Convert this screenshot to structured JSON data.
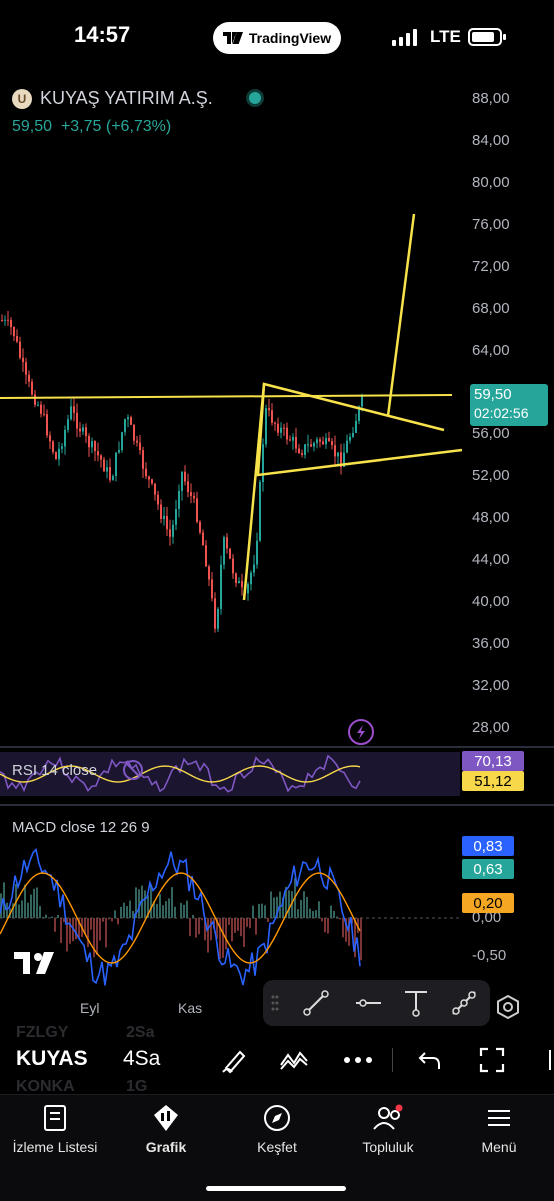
{
  "status_bar": {
    "time": "14:57",
    "center_app": "TradingView",
    "network": "LTE"
  },
  "header": {
    "logo_letter": "U",
    "company": "KUYAŞ YATIRIM A.Ş.",
    "price": "59,50",
    "change": "+3,75 (+6,73%)"
  },
  "price_axis": [
    "88,00",
    "84,00",
    "80,00",
    "76,00",
    "72,00",
    "68,00",
    "64,00",
    "56,00",
    "52,00",
    "48,00",
    "44,00",
    "40,00",
    "36,00",
    "32,00",
    "28,00"
  ],
  "price_tag": {
    "price": "59,50",
    "countdown": "02:02:56"
  },
  "rsi": {
    "title": "RSI 14 close",
    "value_rsi": "70,13",
    "value_ma": "51,12"
  },
  "macd": {
    "title": "MACD close 12 26 9",
    "axis": [
      "0,00",
      "-0,50"
    ],
    "value_macd": "0,83",
    "value_signal": "0,63",
    "value_hist": "0,20"
  },
  "time_axis": [
    "Eyl",
    "Kas"
  ],
  "symbol_row": {
    "symbol": "KUYAS",
    "interval": "4Sa",
    "ghost_rows": [
      {
        "symbol": "FZLGY",
        "interval": "2Sa"
      },
      {
        "symbol": "KONKA",
        "interval": "1G"
      }
    ]
  },
  "bottom_nav": [
    {
      "label": "İzleme Listesi",
      "icon": "book-icon"
    },
    {
      "label": "Grafik",
      "icon": "candles-icon"
    },
    {
      "label": "Keşfet",
      "icon": "compass-icon"
    },
    {
      "label": "Topluluk",
      "icon": "people-icon"
    },
    {
      "label": "Menü",
      "icon": "hamburger-icon"
    }
  ],
  "colors": {
    "up": "#26a69a",
    "down": "#ef5350",
    "drawing": "#f7e24b",
    "rsi": "#7e57c2",
    "macd": "#2962ff",
    "signal": "#ff9800"
  }
}
